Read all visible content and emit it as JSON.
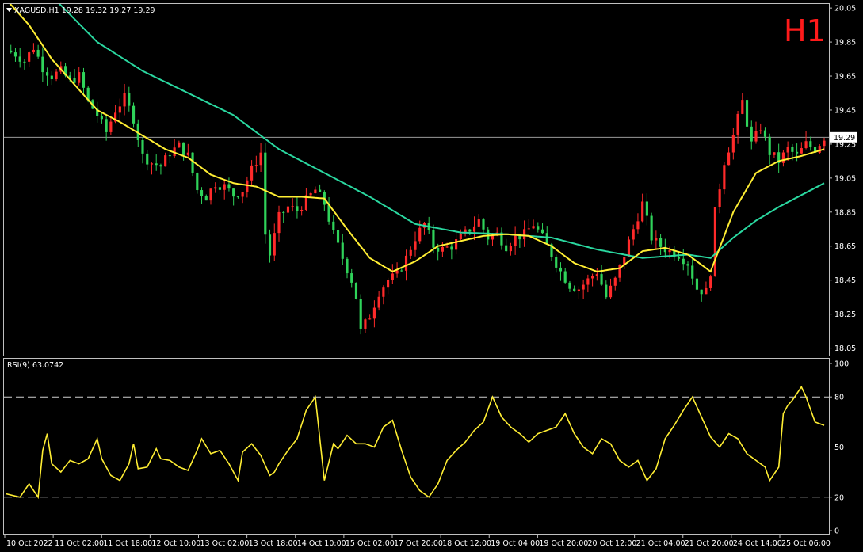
{
  "header": {
    "symbol_line": "XAGUSD,H1  19.28 19.32 19.27 19.29",
    "timeframe_badge": "H1"
  },
  "colors": {
    "background": "#000000",
    "panel_border": "#c0c0c0",
    "bull_candle": "#ff2a2a",
    "bear_candle": "#2fd35a",
    "ma_fast": "#ffee33",
    "ma_slow": "#2ad8a0",
    "rsi_line": "#ffee33",
    "grid_dash": "#cfcfcf",
    "price_line": "#9a9a9a",
    "timeframe_badge": "#ff1a1a"
  },
  "price_panel": {
    "current_price_label": "19.29",
    "y_ticks": [
      "20.05",
      "19.85",
      "19.65",
      "19.45",
      "19.25",
      "19.05",
      "18.85",
      "18.65",
      "18.45",
      "18.25",
      "18.05"
    ]
  },
  "rsi_panel": {
    "title": "RSI(9) 63.0742",
    "y_ticks": [
      "100",
      "80",
      "50",
      "20",
      "0"
    ]
  },
  "x_axis": {
    "labels": [
      "10 Oct 2022",
      "11 Oct 02:00",
      "11 Oct 18:00",
      "12 Oct 10:00",
      "13 Oct 02:00",
      "13 Oct 18:00",
      "14 Oct 10:00",
      "15 Oct 02:00",
      "17 Oct 20:00",
      "18 Oct 12:00",
      "19 Oct 04:00",
      "19 Oct 20:00",
      "20 Oct 12:00",
      "21 Oct 04:00",
      "21 Oct 20:00",
      "24 Oct 14:00",
      "25 Oct 06:00"
    ]
  },
  "chart_data": [
    {
      "type": "candlestick",
      "symbol": "XAGUSD",
      "timeframe": "H1",
      "last_bar": {
        "open": 19.28,
        "high": 19.32,
        "low": 19.27,
        "close": 19.29
      },
      "ylim": [
        18.02,
        20.06
      ],
      "x_labels": [
        "10 Oct 2022",
        "11 Oct 02:00",
        "11 Oct 18:00",
        "12 Oct 10:00",
        "13 Oct 02:00",
        "13 Oct 18:00",
        "14 Oct 10:00",
        "15 Oct 02:00",
        "17 Oct 20:00",
        "18 Oct 12:00",
        "19 Oct 04:00",
        "19 Oct 20:00",
        "20 Oct 12:00",
        "21 Oct 04:00",
        "21 Oct 20:00",
        "24 Oct 14:00",
        "25 Oct 06:00"
      ],
      "close_path": [
        [
          0,
          19.8
        ],
        [
          2,
          19.78
        ],
        [
          4,
          19.74
        ],
        [
          6,
          19.82
        ],
        [
          8,
          19.7
        ],
        [
          10,
          19.65
        ],
        [
          12,
          19.68
        ],
        [
          14,
          19.62
        ],
        [
          16,
          19.65
        ],
        [
          18,
          19.5
        ],
        [
          20,
          19.42
        ],
        [
          22,
          19.32
        ],
        [
          24,
          19.45
        ],
        [
          26,
          19.52
        ],
        [
          28,
          19.4
        ],
        [
          30,
          19.18
        ],
        [
          32,
          19.14
        ],
        [
          34,
          19.12
        ],
        [
          36,
          19.2
        ],
        [
          38,
          19.24
        ],
        [
          40,
          19.18
        ],
        [
          42,
          18.98
        ],
        [
          44,
          18.94
        ],
        [
          46,
          19.02
        ],
        [
          48,
          19.0
        ],
        [
          50,
          18.95
        ],
        [
          52,
          18.98
        ],
        [
          54,
          19.1
        ],
        [
          56,
          19.2
        ],
        [
          57,
          18.72
        ],
        [
          58,
          18.6
        ],
        [
          60,
          18.82
        ],
        [
          62,
          18.88
        ],
        [
          64,
          18.86
        ],
        [
          66,
          18.92
        ],
        [
          68,
          18.98
        ],
        [
          70,
          18.9
        ],
        [
          72,
          18.72
        ],
        [
          74,
          18.58
        ],
        [
          76,
          18.45
        ],
        [
          77,
          18.35
        ],
        [
          78,
          18.15
        ],
        [
          80,
          18.24
        ],
        [
          82,
          18.38
        ],
        [
          84,
          18.45
        ],
        [
          86,
          18.48
        ],
        [
          88,
          18.58
        ],
        [
          90,
          18.7
        ],
        [
          92,
          18.78
        ],
        [
          94,
          18.65
        ],
        [
          96,
          18.63
        ],
        [
          98,
          18.65
        ],
        [
          100,
          18.7
        ],
        [
          102,
          18.75
        ],
        [
          104,
          18.8
        ],
        [
          106,
          18.7
        ],
        [
          108,
          18.72
        ],
        [
          110,
          18.65
        ],
        [
          112,
          18.7
        ],
        [
          114,
          18.72
        ],
        [
          116,
          18.78
        ],
        [
          118,
          18.7
        ],
        [
          120,
          18.6
        ],
        [
          122,
          18.5
        ],
        [
          124,
          18.42
        ],
        [
          126,
          18.4
        ],
        [
          128,
          18.45
        ],
        [
          130,
          18.5
        ],
        [
          132,
          18.35
        ],
        [
          134,
          18.45
        ],
        [
          136,
          18.6
        ],
        [
          138,
          18.75
        ],
        [
          140,
          18.9
        ],
        [
          142,
          18.7
        ],
        [
          144,
          18.65
        ],
        [
          146,
          18.62
        ],
        [
          148,
          18.6
        ],
        [
          150,
          18.55
        ],
        [
          152,
          18.4
        ],
        [
          154,
          18.38
        ],
        [
          155,
          18.5
        ],
        [
          156,
          18.85
        ],
        [
          158,
          19.15
        ],
        [
          160,
          19.3
        ],
        [
          162,
          19.5
        ],
        [
          164,
          19.25
        ],
        [
          166,
          19.35
        ],
        [
          168,
          19.2
        ],
        [
          170,
          19.15
        ],
        [
          172,
          19.22
        ],
        [
          174,
          19.18
        ],
        [
          176,
          19.25
        ],
        [
          178,
          19.22
        ],
        [
          180,
          19.29
        ]
      ],
      "ma_fast_path": [
        [
          0,
          20.1
        ],
        [
          5,
          19.95
        ],
        [
          10,
          19.75
        ],
        [
          15,
          19.6
        ],
        [
          20,
          19.45
        ],
        [
          25,
          19.38
        ],
        [
          30,
          19.3
        ],
        [
          35,
          19.22
        ],
        [
          40,
          19.17
        ],
        [
          45,
          19.07
        ],
        [
          50,
          19.02
        ],
        [
          55,
          19.0
        ],
        [
          60,
          18.94
        ],
        [
          65,
          18.94
        ],
        [
          70,
          18.93
        ],
        [
          75,
          18.75
        ],
        [
          80,
          18.58
        ],
        [
          85,
          18.5
        ],
        [
          90,
          18.56
        ],
        [
          95,
          18.65
        ],
        [
          100,
          18.68
        ],
        [
          105,
          18.71
        ],
        [
          110,
          18.72
        ],
        [
          115,
          18.71
        ],
        [
          120,
          18.65
        ],
        [
          125,
          18.55
        ],
        [
          130,
          18.5
        ],
        [
          135,
          18.52
        ],
        [
          140,
          18.62
        ],
        [
          145,
          18.64
        ],
        [
          150,
          18.6
        ],
        [
          155,
          18.5
        ],
        [
          160,
          18.85
        ],
        [
          165,
          19.08
        ],
        [
          170,
          19.15
        ],
        [
          175,
          19.18
        ],
        [
          180,
          19.22
        ]
      ],
      "ma_slow_path": [
        [
          0,
          20.35
        ],
        [
          10,
          20.12
        ],
        [
          20,
          19.85
        ],
        [
          30,
          19.68
        ],
        [
          40,
          19.55
        ],
        [
          50,
          19.42
        ],
        [
          60,
          19.22
        ],
        [
          70,
          19.08
        ],
        [
          80,
          18.94
        ],
        [
          90,
          18.78
        ],
        [
          100,
          18.73
        ],
        [
          110,
          18.72
        ],
        [
          120,
          18.7
        ],
        [
          130,
          18.63
        ],
        [
          140,
          18.58
        ],
        [
          150,
          18.6
        ],
        [
          155,
          18.58
        ],
        [
          160,
          18.7
        ],
        [
          165,
          18.8
        ],
        [
          170,
          18.88
        ],
        [
          175,
          18.95
        ],
        [
          180,
          19.02
        ]
      ]
    },
    {
      "type": "line",
      "name": "RSI(9)",
      "last_value": 63.0742,
      "ylim": [
        0,
        100
      ],
      "levels": [
        20,
        50,
        80
      ],
      "points": [
        [
          0,
          22
        ],
        [
          3,
          20
        ],
        [
          5,
          28
        ],
        [
          7,
          20
        ],
        [
          8,
          48
        ],
        [
          9,
          58
        ],
        [
          10,
          40
        ],
        [
          12,
          35
        ],
        [
          14,
          42
        ],
        [
          16,
          40
        ],
        [
          18,
          43
        ],
        [
          20,
          55
        ],
        [
          21,
          43
        ],
        [
          23,
          33
        ],
        [
          25,
          30
        ],
        [
          27,
          40
        ],
        [
          28,
          52
        ],
        [
          29,
          37
        ],
        [
          31,
          38
        ],
        [
          33,
          49
        ],
        [
          34,
          43
        ],
        [
          36,
          42
        ],
        [
          38,
          38
        ],
        [
          40,
          36
        ],
        [
          42,
          48
        ],
        [
          43,
          55
        ],
        [
          45,
          46
        ],
        [
          47,
          48
        ],
        [
          49,
          40
        ],
        [
          51,
          30
        ],
        [
          52,
          47
        ],
        [
          54,
          52
        ],
        [
          56,
          45
        ],
        [
          58,
          33
        ],
        [
          59,
          35
        ],
        [
          60,
          40
        ],
        [
          62,
          48
        ],
        [
          64,
          55
        ],
        [
          66,
          72
        ],
        [
          68,
          80
        ],
        [
          70,
          30
        ],
        [
          72,
          52
        ],
        [
          73,
          49
        ],
        [
          75,
          57
        ],
        [
          77,
          52
        ],
        [
          79,
          52
        ],
        [
          81,
          50
        ],
        [
          83,
          62
        ],
        [
          85,
          66
        ],
        [
          87,
          48
        ],
        [
          89,
          32
        ],
        [
          91,
          24
        ],
        [
          93,
          20
        ],
        [
          95,
          28
        ],
        [
          97,
          42
        ],
        [
          99,
          48
        ],
        [
          101,
          53
        ],
        [
          103,
          60
        ],
        [
          105,
          65
        ],
        [
          107,
          80
        ],
        [
          109,
          68
        ],
        [
          111,
          62
        ],
        [
          113,
          58
        ],
        [
          115,
          53
        ],
        [
          117,
          58
        ],
        [
          119,
          60
        ],
        [
          121,
          62
        ],
        [
          123,
          70
        ],
        [
          125,
          58
        ],
        [
          127,
          50
        ],
        [
          129,
          46
        ],
        [
          131,
          55
        ],
        [
          133,
          52
        ],
        [
          135,
          42
        ],
        [
          137,
          38
        ],
        [
          139,
          42
        ],
        [
          141,
          30
        ],
        [
          143,
          37
        ],
        [
          145,
          55
        ],
        [
          147,
          63
        ],
        [
          149,
          72
        ],
        [
          151,
          80
        ],
        [
          153,
          68
        ],
        [
          155,
          56
        ],
        [
          157,
          50
        ],
        [
          159,
          58
        ],
        [
          161,
          55
        ],
        [
          163,
          46
        ],
        [
          165,
          42
        ],
        [
          167,
          38
        ],
        [
          168,
          30
        ],
        [
          170,
          38
        ],
        [
          171,
          70
        ],
        [
          172,
          75
        ],
        [
          173,
          78
        ],
        [
          175,
          86
        ],
        [
          176,
          80
        ],
        [
          178,
          65
        ],
        [
          180,
          63
        ]
      ]
    }
  ]
}
